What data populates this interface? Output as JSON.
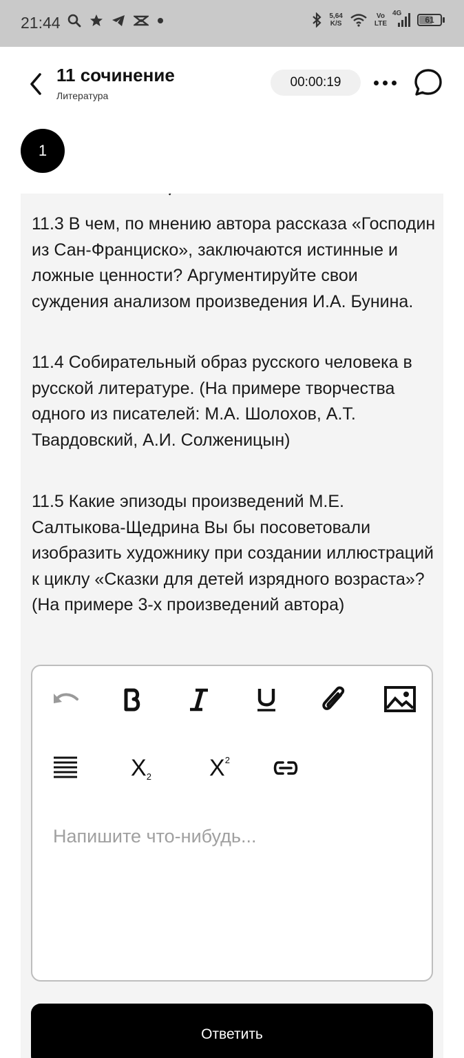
{
  "status_bar": {
    "time": "21:44",
    "net_speed_value": "5,64",
    "net_speed_unit": "K/S",
    "volte_top": "Vo",
    "volte_bottom": "LTE",
    "signal_label": "4G",
    "battery_level": "61"
  },
  "header": {
    "title": "11 сочинение",
    "subtitle": "Литература",
    "timer": "00:00:19"
  },
  "step": {
    "number": "1"
  },
  "questions": [
    "11.3 В чем, по мнению автора рассказа «Господин из Сан-Франциско», заключаются истинные и ложные ценности? Аргументируйте свои суждения анализом произведения И.А. Бунина.",
    "11.4 Собирательный образ русского человека в русской литературе. (На примере творчества одного из писателей: М.А. Шолохов, А.Т. Твардовский, А.И. Солженицын)",
    "11.5 Какие эпизоды произведений М.Е. Салтыкова-Щедрина Вы бы посоветовали изобразить художнику при создании иллюстраций к циклу «Сказки для детей изрядного возраста»? (На примере 3-х произведений автора)"
  ],
  "editor": {
    "placeholder": "Напишите что-нибудь...",
    "subscript_label": "X",
    "subscript_mark": "2",
    "superscript_label": "X",
    "superscript_mark": "2"
  },
  "submit_label": "Ответить",
  "colors": {
    "status_bar_bg": "#c9c9c9",
    "content_bg": "#f4f4f4",
    "primary": "#000000",
    "placeholder": "#a0a0a0"
  }
}
